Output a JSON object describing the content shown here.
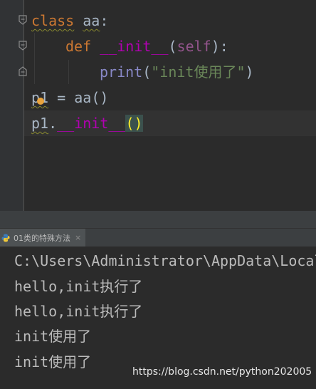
{
  "editor": {
    "line1": {
      "keyword": "class",
      "name": "aa",
      "colon": ":"
    },
    "line2": {
      "keyword": "def",
      "name": "__init__",
      "open": "(",
      "param": "self",
      "close": "):"
    },
    "line3": {
      "builtin": "print",
      "open": "(",
      "string": "\"init使用了\"",
      "close": ")"
    },
    "line4": {
      "var": "p1",
      "op": " = ",
      "call": "aa",
      "parens": "()"
    },
    "line5": {
      "var": "p1",
      "dot": ".",
      "method": "__init__",
      "open": "(",
      "close": ")"
    }
  },
  "run_tab": {
    "label": "01类的特殊方法",
    "close": "×"
  },
  "console": {
    "lines": [
      "C:\\Users\\Administrator\\AppData\\Local",
      "hello,init执行了",
      "hello,init执行了",
      "init使用了",
      "init使用了"
    ]
  },
  "watermark": "https://blog.csdn.net/python202005",
  "colors": {
    "background": "#2b2b2b",
    "keyword": "#cc7832",
    "function_def": "#b200b2",
    "self": "#94558d",
    "builtin": "#8888c6",
    "string": "#6a8759",
    "bracket_match": "#ffef28"
  }
}
